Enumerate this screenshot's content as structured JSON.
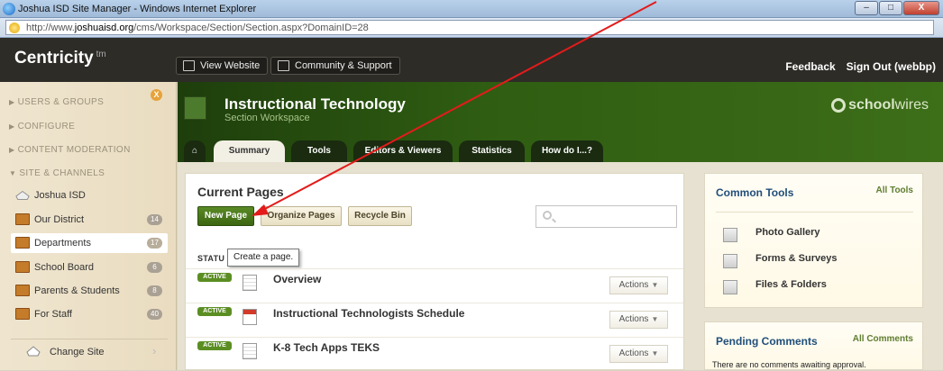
{
  "window": {
    "title": "Joshua ISD Site Manager - Windows Internet Explorer",
    "controls": [
      "–",
      "□",
      "X"
    ]
  },
  "address": {
    "prefix": "http://www.",
    "domain": "joshuaisd.org",
    "path": "/cms/Workspace/Section/Section.aspx?DomainID=28"
  },
  "topnav": {
    "brand": "Centricity",
    "brand_tm": "tm",
    "view_website": "View Website",
    "community_support": "Community & Support",
    "feedback": "Feedback",
    "sign_out": "Sign Out (webbp)"
  },
  "sidebar": {
    "close": "X",
    "sections": [
      "USERS & GROUPS",
      "CONFIGURE",
      "CONTENT MODERATION",
      "SITE & CHANNELS"
    ],
    "site": "Joshua ISD",
    "items": [
      {
        "label": "Our District",
        "count": "14"
      },
      {
        "label": "Departments",
        "count": "17"
      },
      {
        "label": "School Board",
        "count": "6"
      },
      {
        "label": "Parents & Students",
        "count": "8"
      },
      {
        "label": "For Staff",
        "count": "40"
      }
    ],
    "change_site": "Change Site"
  },
  "header": {
    "title": "Instructional Technology",
    "subtitle": "Section Workspace",
    "logo_bold": "school",
    "logo_light": "wires",
    "tabs": [
      "Summary",
      "Tools",
      "Editors & Viewers",
      "Statistics",
      "How do I...?"
    ]
  },
  "main": {
    "title": "Current Pages",
    "buttons": {
      "new_page": "New Page",
      "organize": "Organize Pages",
      "recycle": "Recycle Bin"
    },
    "search_placeholder": "",
    "status_header": "STATU",
    "tooltip": "Create a page.",
    "pages": [
      {
        "status": "ACTIVE",
        "title": "Overview",
        "actions": "Actions"
      },
      {
        "status": "ACTIVE",
        "title": "Instructional Technologists Schedule",
        "actions": "Actions"
      },
      {
        "status": "ACTIVE",
        "title": "K-8 Tech Apps TEKS",
        "actions": "Actions"
      }
    ]
  },
  "common_tools": {
    "title": "Common Tools",
    "link": "All Tools",
    "items": [
      "Photo Gallery",
      "Forms & Surveys",
      "Files & Folders"
    ]
  },
  "pending_comments": {
    "title": "Pending Comments",
    "link": "All Comments",
    "text": "There are no comments awaiting approval."
  },
  "colors": {
    "accent_green": "#3c6612",
    "annotation_arrow": "#e31b1b"
  }
}
